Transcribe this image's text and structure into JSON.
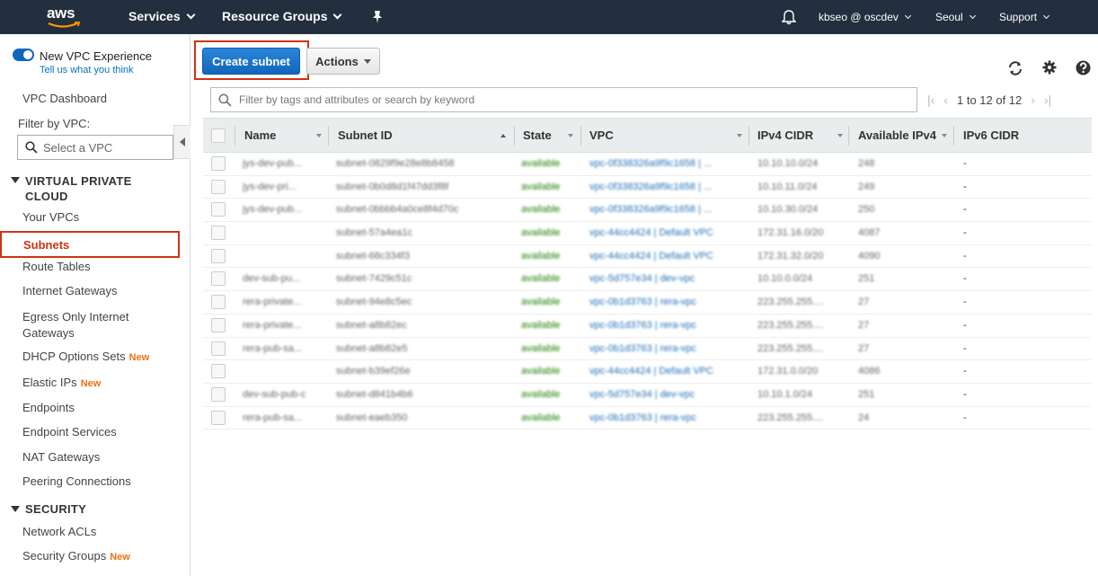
{
  "topnav": {
    "logo": "aws",
    "services": "Services",
    "resource_groups": "Resource Groups",
    "pin_icon": "pushpin-icon",
    "bell_icon": "bell-icon",
    "account": "kbseo @ oscdev",
    "region": "Seoul",
    "support": "Support"
  },
  "sidebar": {
    "new_vpc_title": "New VPC Experience",
    "new_vpc_link": "Tell us what you think",
    "dashboard": "VPC Dashboard",
    "filter_label": "Filter by VPC:",
    "filter_placeholder": "Select a VPC",
    "section_vpc": "VIRTUAL PRIVATE CLOUD",
    "section_vpc_line1": "VIRTUAL PRIVATE",
    "section_vpc_line2": "CLOUD",
    "items": [
      {
        "label": "Your VPCs"
      },
      {
        "label": "Subnets"
      },
      {
        "label": "Route Tables"
      },
      {
        "label": "Internet Gateways"
      },
      {
        "label": "Egress Only Internet Gateways"
      },
      {
        "label": "DHCP Options Sets",
        "badge": "New"
      },
      {
        "label": "Elastic IPs",
        "badge": "New"
      },
      {
        "label": "Endpoints"
      },
      {
        "label": "Endpoint Services"
      },
      {
        "label": "NAT Gateways"
      },
      {
        "label": "Peering Connections"
      }
    ],
    "egress_line1": "Egress Only Internet",
    "egress_line2": "Gateways",
    "section_security": "SECURITY",
    "security_items": [
      {
        "label": "Network ACLs"
      },
      {
        "label": "Security Groups",
        "badge": "New"
      }
    ]
  },
  "toolbar": {
    "create_label": "Create subnet",
    "actions_label": "Actions"
  },
  "search": {
    "placeholder": "Filter by tags and attributes or search by keyword"
  },
  "pager": {
    "range": "1 to 12 of 12"
  },
  "table": {
    "columns": [
      "Name",
      "Subnet ID",
      "State",
      "VPC",
      "IPv4 CIDR",
      "Available IPv4",
      "IPv6 CIDR"
    ],
    "rows": [
      {
        "name": "jys-dev-pub...",
        "subnet_id": "subnet-0829f9e28e8b8458",
        "state": "available",
        "vpc": "vpc-0f338326a9f9c1658 | ...",
        "ipv4": "10.10.10.0/24",
        "avail": "248",
        "ipv6": "-"
      },
      {
        "name": "jys-dev-pri...",
        "subnet_id": "subnet-0b0d8d1f47dd3f8f",
        "state": "available",
        "vpc": "vpc-0f338326a9f9c1658 | ...",
        "ipv4": "10.10.11.0/24",
        "avail": "249",
        "ipv6": "-"
      },
      {
        "name": "jys-dev-pub...",
        "subnet_id": "subnet-0bbbb4a0ce8f4d70c",
        "state": "available",
        "vpc": "vpc-0f338326a9f9c1658 | ...",
        "ipv4": "10.10.30.0/24",
        "avail": "250",
        "ipv6": "-"
      },
      {
        "name": "",
        "subnet_id": "subnet-57a4ea1c",
        "state": "available",
        "vpc": "vpc-44cc4424 | Default VPC",
        "ipv4": "172.31.16.0/20",
        "avail": "4087",
        "ipv6": "-"
      },
      {
        "name": "",
        "subnet_id": "subnet-68c334f3",
        "state": "available",
        "vpc": "vpc-44cc4424 | Default VPC",
        "ipv4": "172.31.32.0/20",
        "avail": "4090",
        "ipv6": "-"
      },
      {
        "name": "dev-sub-pu...",
        "subnet_id": "subnet-7429c51c",
        "state": "available",
        "vpc": "vpc-5d757e34 | dev-vpc",
        "ipv4": "10.10.0.0/24",
        "avail": "251",
        "ipv6": "-"
      },
      {
        "name": "rera-private...",
        "subnet_id": "subnet-94e8c5ec",
        "state": "available",
        "vpc": "vpc-0b1d3763 | rera-vpc",
        "ipv4": "223.255.255....",
        "avail": "27",
        "ipv6": "-"
      },
      {
        "name": "rera-private...",
        "subnet_id": "subnet-a8b82ec",
        "state": "available",
        "vpc": "vpc-0b1d3763 | rera-vpc",
        "ipv4": "223.255.255....",
        "avail": "27",
        "ipv6": "-"
      },
      {
        "name": "rera-pub-sa...",
        "subnet_id": "subnet-a8b82e5",
        "state": "available",
        "vpc": "vpc-0b1d3763 | rera-vpc",
        "ipv4": "223.255.255....",
        "avail": "27",
        "ipv6": "-"
      },
      {
        "name": "",
        "subnet_id": "subnet-b39ef26e",
        "state": "available",
        "vpc": "vpc-44cc4424 | Default VPC",
        "ipv4": "172.31.0.0/20",
        "avail": "4086",
        "ipv6": "-"
      },
      {
        "name": "dev-sub-pub-c",
        "subnet_id": "subnet-d841b4b6",
        "state": "available",
        "vpc": "vpc-5d757e34 | dev-vpc",
        "ipv4": "10.10.1.0/24",
        "avail": "251",
        "ipv6": "-"
      },
      {
        "name": "rera-pub-sa...",
        "subnet_id": "subnet-eaeb350",
        "state": "available",
        "vpc": "vpc-0b1d3763 | rera-vpc",
        "ipv4": "223.255.255....",
        "avail": "24",
        "ipv6": "-"
      }
    ]
  }
}
